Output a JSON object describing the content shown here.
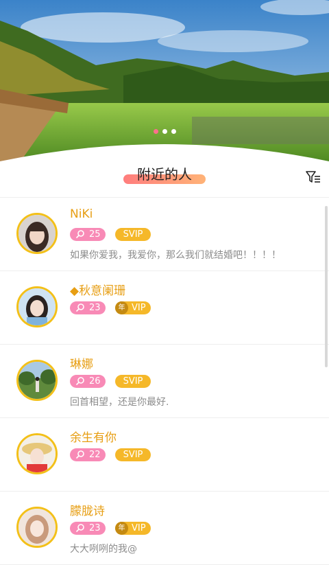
{
  "banner": {
    "slide_count": 3,
    "active_slide": 1,
    "colors": {
      "sky": "#3d8ad0",
      "mountain": "#3f6b20",
      "grass": "#7fb63a"
    }
  },
  "header": {
    "title": "附近的人",
    "filter_icon": "filter-icon"
  },
  "users": [
    {
      "name": "NiKi",
      "age": "25",
      "vip_type": "svip",
      "vip_label": "SVIP",
      "year_label": "",
      "signature": "如果你爱我，我爱你，那么我们就结婚吧！！！！"
    },
    {
      "name": "◆秋意阑珊",
      "age": "23",
      "vip_type": "year",
      "vip_label": "VIP",
      "year_label": "年",
      "signature": ""
    },
    {
      "name": "琳娜",
      "age": "26",
      "vip_type": "svip",
      "vip_label": "SVIP",
      "year_label": "",
      "signature": "回首相望，还是你最好."
    },
    {
      "name": "余生有你",
      "age": "22",
      "vip_type": "svip",
      "vip_label": "SVIP",
      "year_label": "",
      "signature": ""
    },
    {
      "name": "朦胧诗",
      "age": "23",
      "vip_type": "year",
      "vip_label": "VIP",
      "year_label": "年",
      "signature": "大大咧咧的我@"
    }
  ],
  "colors": {
    "name": "#e79e13",
    "age_badge": "#f88ab6",
    "vip_badge": "#f5b829",
    "avatar_ring": "#f3c019"
  }
}
